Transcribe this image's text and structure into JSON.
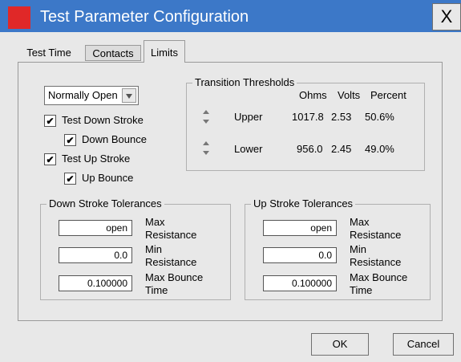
{
  "window": {
    "title": "Test Parameter Configuration",
    "close_label": "X"
  },
  "tabs": [
    {
      "label": "Test Time"
    },
    {
      "label": "Contacts"
    },
    {
      "label": "Limits"
    }
  ],
  "contact_type": {
    "selected": "Normally Open"
  },
  "checks": {
    "test_down_stroke": {
      "label": "Test Down Stroke",
      "mark": "✔"
    },
    "down_bounce": {
      "label": "Down Bounce",
      "mark": "✔"
    },
    "test_up_stroke": {
      "label": "Test Up Stroke",
      "mark": "✔"
    },
    "up_bounce": {
      "label": "Up Bounce",
      "mark": "✔"
    }
  },
  "thresholds": {
    "title": "Transition Thresholds",
    "headers": {
      "ohms": "Ohms",
      "volts": "Volts",
      "percent": "Percent"
    },
    "upper": {
      "label": "Upper",
      "ohms": "1017.8",
      "volts": "2.53",
      "percent": "50.6%"
    },
    "lower": {
      "label": "Lower",
      "ohms": "956.0",
      "volts": "2.45",
      "percent": "49.0%"
    }
  },
  "down_tol": {
    "title": "Down Stroke Tolerances",
    "max_res": {
      "value": "open",
      "label1": "Max",
      "label2": "Resistance"
    },
    "min_res": {
      "value": "0.0",
      "label1": "Min",
      "label2": "Resistance"
    },
    "bounce": {
      "value": "0.100000",
      "label1": "Max Bounce",
      "label2": "Time"
    }
  },
  "up_tol": {
    "title": "Up Stroke Tolerances",
    "max_res": {
      "value": "open",
      "label1": "Max",
      "label2": "Resistance"
    },
    "min_res": {
      "value": "0.0",
      "label1": "Min",
      "label2": "Resistance"
    },
    "bounce": {
      "value": "0.100000",
      "label1": "Max Bounce",
      "label2": "Time"
    }
  },
  "buttons": {
    "ok": "OK",
    "cancel": "Cancel"
  },
  "colors": {
    "titlebar": "#3c78c8",
    "app_icon": "#e02828",
    "dialog_bg": "#e8e8e8"
  }
}
